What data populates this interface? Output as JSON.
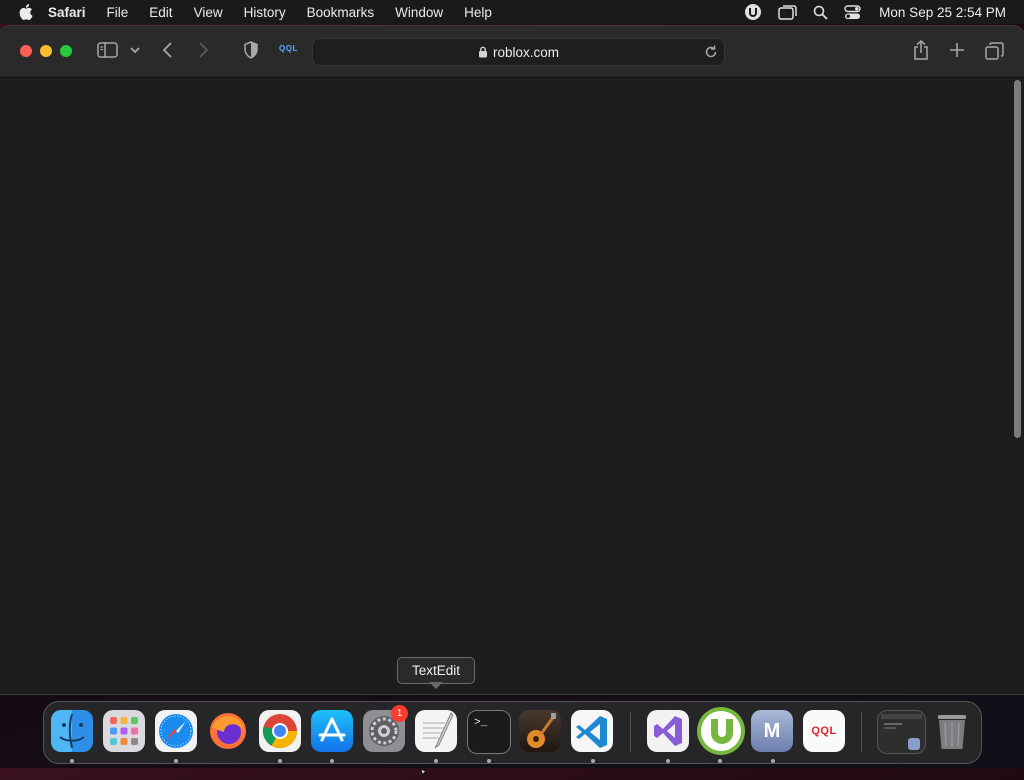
{
  "menubar": {
    "app_name": "Safari",
    "items": [
      "File",
      "Edit",
      "View",
      "History",
      "Bookmarks",
      "Window",
      "Help"
    ],
    "clock": "Mon Sep 25  2:54 PM"
  },
  "toolbar": {
    "extension_label": "QQL",
    "url": "roblox.com"
  },
  "tooltip": {
    "text": "TextEdit"
  },
  "dock": {
    "badge_count": "1",
    "app_icons": [
      "finder-icon",
      "launchpad-icon",
      "safari-icon",
      "firefox-icon",
      "chrome-icon",
      "app-store-icon",
      "system-settings-icon",
      "textedit-icon",
      "terminal-icon",
      "garageband-icon",
      "vscode-icon",
      "visual-studio-icon",
      "utorrent-icon",
      "m-app-icon",
      "qql-app-icon",
      "window-preview-icon",
      "trash-icon"
    ],
    "m_app_label": "M",
    "qql_app_label": "QQL",
    "terminal_prompt": ">_"
  }
}
